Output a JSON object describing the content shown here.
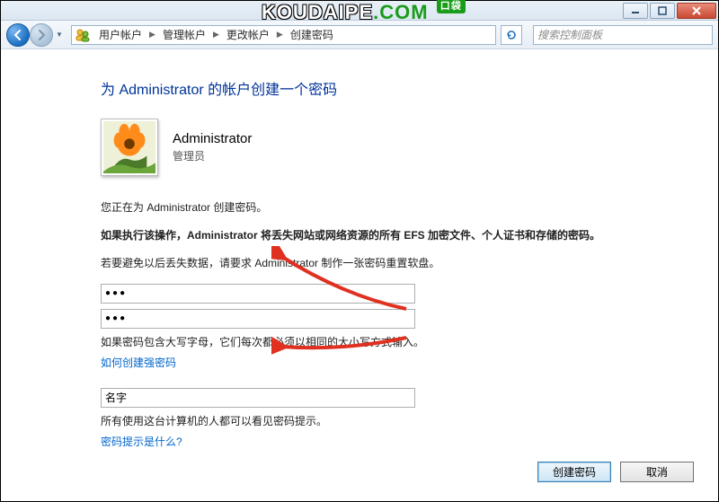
{
  "watermark": {
    "part1": "KOUDAIPE",
    "part2": ".COM",
    "badge": "口袋"
  },
  "breadcrumb": {
    "items": [
      {
        "label": "用户帐户"
      },
      {
        "label": "管理帐户"
      },
      {
        "label": "更改帐户"
      },
      {
        "label": "创建密码"
      }
    ]
  },
  "search": {
    "placeholder": "搜索控制面板"
  },
  "page": {
    "title": "为 Administrator 的帐户创建一个密码",
    "username": "Administrator",
    "userrole": "管理员",
    "info_line": "您正在为 Administrator 创建密码。",
    "warning_line": "如果执行该操作，Administrator 将丢失网站或网络资源的所有 EFS 加密文件、个人证书和存储的密码。",
    "avoid_line": "若要避免以后丢失数据，请要求 Administrator 制作一张密码重置软盘。",
    "pwd_mask": "●●●",
    "pwd_confirm_mask": "●●●",
    "case_note": "如果密码包含大写字母，它们每次都必须以相同的大小写方式输入。",
    "link_strong": "如何创建强密码",
    "hint_value": "名字",
    "hint_note": "所有使用这台计算机的人都可以看见密码提示。",
    "link_hint": "密码提示是什么?"
  },
  "buttons": {
    "create": "创建密码",
    "cancel": "取消"
  }
}
